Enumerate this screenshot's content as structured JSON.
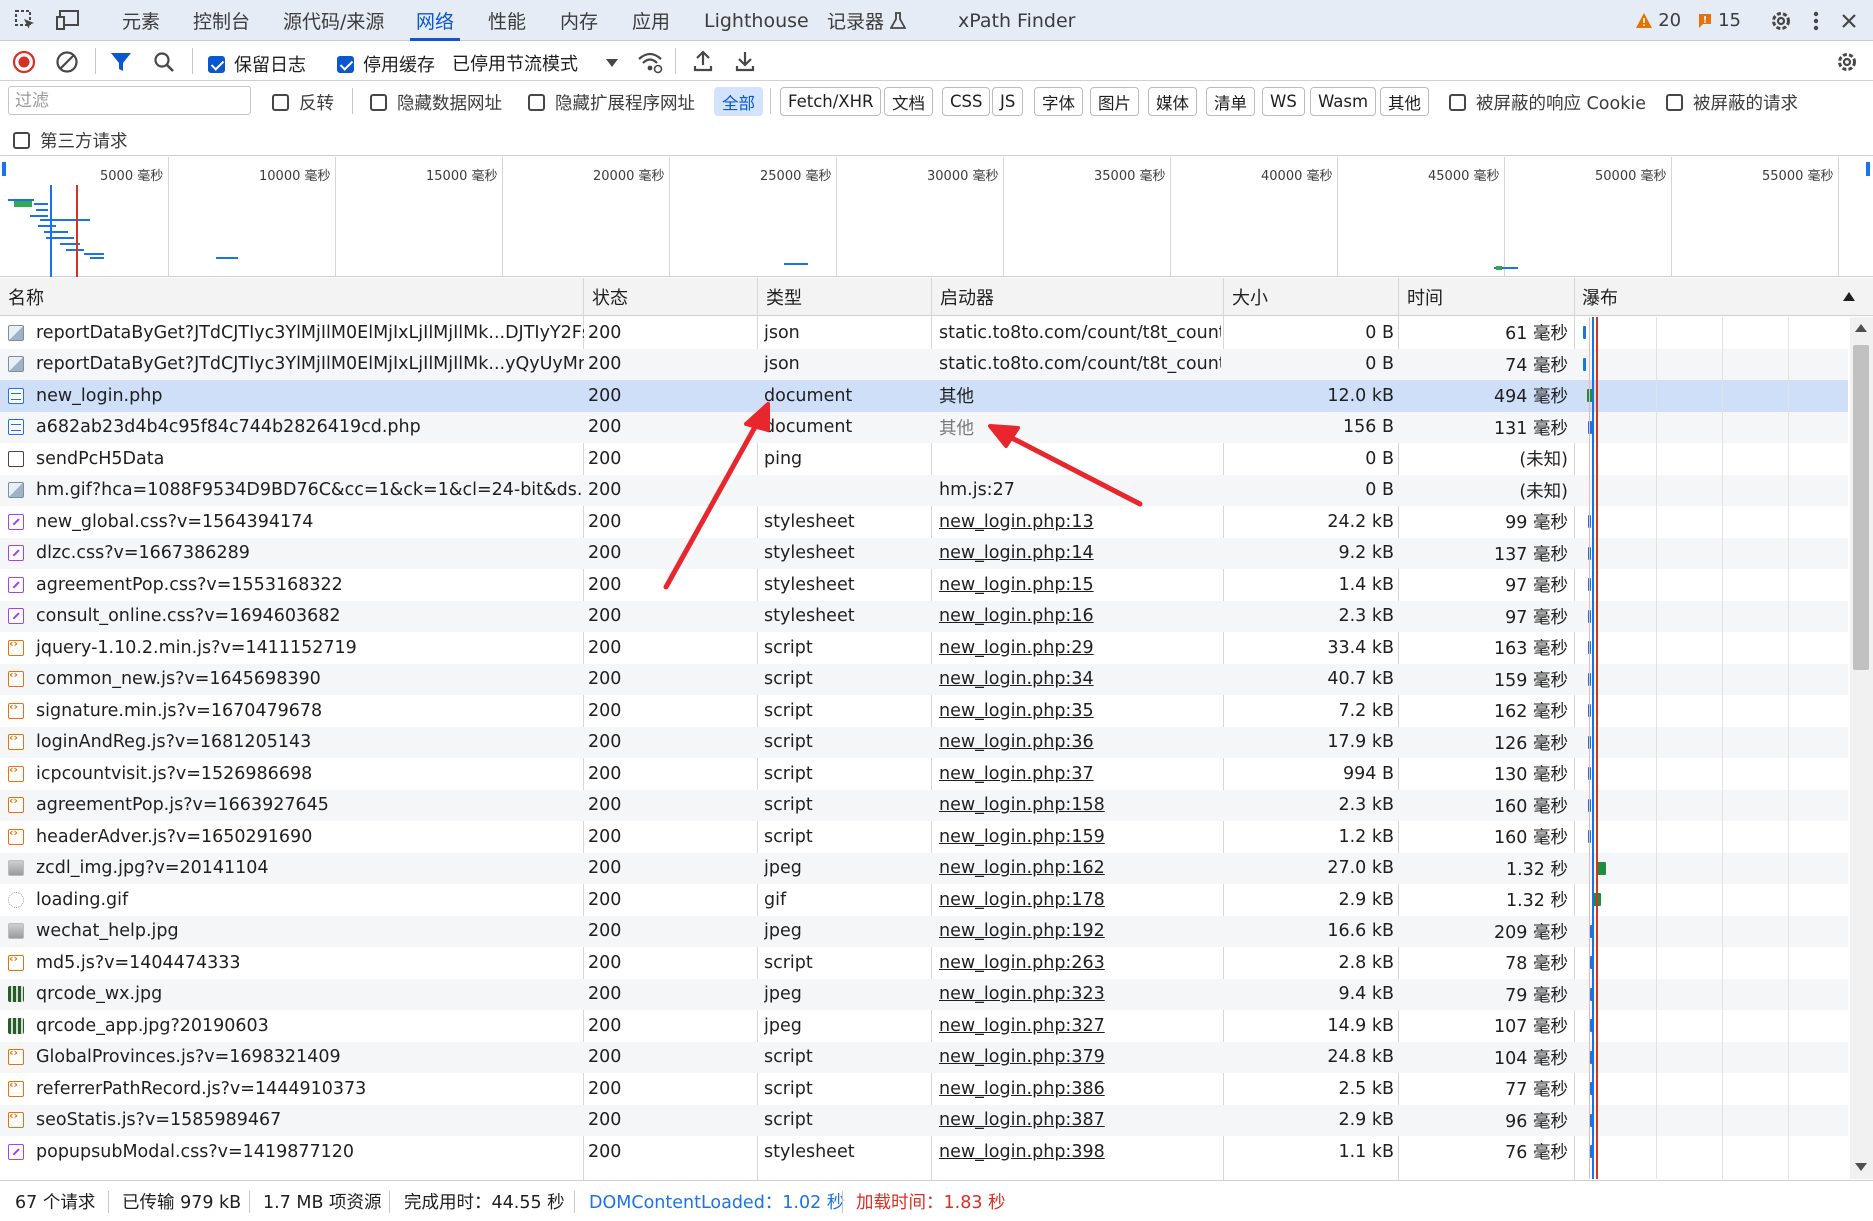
{
  "tabs": [
    "元素",
    "控制台",
    "源代码/来源",
    "网络",
    "性能",
    "内存",
    "应用",
    "Lighthouse",
    "记录器",
    "xPath Finder"
  ],
  "active_tab": "网络",
  "badges": {
    "warnings": "20",
    "issues": "15"
  },
  "toolbar": {
    "preserve_log": "保留日志",
    "disable_cache": "停用缓存",
    "throttling": "已停用节流模式"
  },
  "filter": {
    "placeholder": "过滤",
    "invert": "反转",
    "hide_data_urls": "隐藏数据网址",
    "hide_ext_urls": "隐藏扩展程序网址",
    "types": [
      "全部",
      "Fetch/XHR",
      "文档",
      "CSS",
      "JS",
      "字体",
      "图片",
      "媒体",
      "清单",
      "WS",
      "Wasm",
      "其他"
    ],
    "active_type": "全部",
    "blocked_cookies": "被屏蔽的响应 Cookie",
    "blocked_requests": "被屏蔽的请求",
    "third_party": "第三方请求"
  },
  "overview_ticks": [
    "5000 毫秒",
    "10000 毫秒",
    "15000 毫秒",
    "20000 毫秒",
    "25000 毫秒",
    "30000 毫秒",
    "35000 毫秒",
    "40000 毫秒",
    "45000 毫秒",
    "50000 毫秒",
    "55000 毫秒"
  ],
  "columns": {
    "name": "名称",
    "status": "状态",
    "type": "类型",
    "initiator": "启动器",
    "size": "大小",
    "time": "时间",
    "waterfall": "瀑布"
  },
  "rows": [
    {
      "name": "reportDataByGet?JTdCJTIyc3YlMjIlM0ElMjIxLjIlMjIlMk...DJTIyY2Fsb...",
      "status": "200",
      "type": "json",
      "initiator": "static.to8to.com/count/t8t_count....",
      "size": "0 B",
      "time": "61 毫秒",
      "icon": "image-icon"
    },
    {
      "name": "reportDataByGet?JTdCJTIyc3YlMjIlM0ElMjIxLjIlMjIlMk...yQyUyMm...",
      "status": "200",
      "type": "json",
      "initiator": "static.to8to.com/count/t8t_count....",
      "size": "0 B",
      "time": "74 毫秒",
      "icon": "image-icon"
    },
    {
      "name": "new_login.php",
      "status": "200",
      "type": "document",
      "initiator": "其他",
      "size": "12.0 kB",
      "time": "494 毫秒",
      "icon": "document-icon"
    },
    {
      "name": "a682ab23d4b4c95f84c744b2826419cd.php",
      "status": "200",
      "type": "document",
      "initiator": "其他",
      "size": "156 B",
      "time": "131 毫秒",
      "icon": "document-icon"
    },
    {
      "name": "sendPcH5Data",
      "status": "200",
      "type": "ping",
      "initiator": "",
      "size": "0 B",
      "time": "(未知)",
      "icon": "ping-icon"
    },
    {
      "name": "hm.gif?hca=1088F9534D9BD76C&cc=1&ck=1&cl=24-bit&ds...44...",
      "status": "200",
      "type": "",
      "initiator": "hm.js:27",
      "size": "0 B",
      "time": "(未知)",
      "icon": "image-icon"
    },
    {
      "name": "new_global.css?v=1564394174",
      "status": "200",
      "type": "stylesheet",
      "initiator": "new_login.php:13",
      "size": "24.2 kB",
      "time": "99 毫秒",
      "icon": "stylesheet-icon"
    },
    {
      "name": "dlzc.css?v=1667386289",
      "status": "200",
      "type": "stylesheet",
      "initiator": "new_login.php:14",
      "size": "9.2 kB",
      "time": "137 毫秒",
      "icon": "stylesheet-icon"
    },
    {
      "name": "agreementPop.css?v=1553168322",
      "status": "200",
      "type": "stylesheet",
      "initiator": "new_login.php:15",
      "size": "1.4 kB",
      "time": "97 毫秒",
      "icon": "stylesheet-icon"
    },
    {
      "name": "consult_online.css?v=1694603682",
      "status": "200",
      "type": "stylesheet",
      "initiator": "new_login.php:16",
      "size": "2.3 kB",
      "time": "97 毫秒",
      "icon": "stylesheet-icon"
    },
    {
      "name": "jquery-1.10.2.min.js?v=1411152719",
      "status": "200",
      "type": "script",
      "initiator": "new_login.php:29",
      "size": "33.4 kB",
      "time": "163 毫秒",
      "icon": "script-icon"
    },
    {
      "name": "common_new.js?v=1645698390",
      "status": "200",
      "type": "script",
      "initiator": "new_login.php:34",
      "size": "40.7 kB",
      "time": "159 毫秒",
      "icon": "script-icon"
    },
    {
      "name": "signature.min.js?v=1670479678",
      "status": "200",
      "type": "script",
      "initiator": "new_login.php:35",
      "size": "7.2 kB",
      "time": "162 毫秒",
      "icon": "script-icon"
    },
    {
      "name": "loginAndReg.js?v=1681205143",
      "status": "200",
      "type": "script",
      "initiator": "new_login.php:36",
      "size": "17.9 kB",
      "time": "126 毫秒",
      "icon": "script-icon"
    },
    {
      "name": "icpcountvisit.js?v=1526986698",
      "status": "200",
      "type": "script",
      "initiator": "new_login.php:37",
      "size": "994 B",
      "time": "130 毫秒",
      "icon": "script-icon"
    },
    {
      "name": "agreementPop.js?v=1663927645",
      "status": "200",
      "type": "script",
      "initiator": "new_login.php:158",
      "size": "2.3 kB",
      "time": "160 毫秒",
      "icon": "script-icon"
    },
    {
      "name": "headerAdver.js?v=1650291690",
      "status": "200",
      "type": "script",
      "initiator": "new_login.php:159",
      "size": "1.2 kB",
      "time": "160 毫秒",
      "icon": "script-icon"
    },
    {
      "name": "zcdl_img.jpg?v=20141104",
      "status": "200",
      "type": "jpeg",
      "initiator": "new_login.php:162",
      "size": "27.0 kB",
      "time": "1.32 秒",
      "icon": "jpeg-thumbnail-icon"
    },
    {
      "name": "loading.gif",
      "status": "200",
      "type": "gif",
      "initiator": "new_login.php:178",
      "size": "2.9 kB",
      "time": "1.32 秒",
      "icon": "gif-thumbnail-icon"
    },
    {
      "name": "wechat_help.jpg",
      "status": "200",
      "type": "jpeg",
      "initiator": "new_login.php:192",
      "size": "16.6 kB",
      "time": "209 毫秒",
      "icon": "jpeg-thumbnail-icon"
    },
    {
      "name": "md5.js?v=1404474333",
      "status": "200",
      "type": "script",
      "initiator": "new_login.php:263",
      "size": "2.8 kB",
      "time": "78 毫秒",
      "icon": "script-icon"
    },
    {
      "name": "qrcode_wx.jpg",
      "status": "200",
      "type": "jpeg",
      "initiator": "new_login.php:323",
      "size": "9.4 kB",
      "time": "79 毫秒",
      "icon": "qrcode-thumbnail-icon"
    },
    {
      "name": "qrcode_app.jpg?20190603",
      "status": "200",
      "type": "jpeg",
      "initiator": "new_login.php:327",
      "size": "14.9 kB",
      "time": "107 毫秒",
      "icon": "qrcode-thumbnail-icon"
    },
    {
      "name": "GlobalProvinces.js?v=1698321409",
      "status": "200",
      "type": "script",
      "initiator": "new_login.php:379",
      "size": "24.8 kB",
      "time": "104 毫秒",
      "icon": "script-icon"
    },
    {
      "name": "referrerPathRecord.js?v=1444910373",
      "status": "200",
      "type": "script",
      "initiator": "new_login.php:386",
      "size": "2.5 kB",
      "time": "77 毫秒",
      "icon": "script-icon"
    },
    {
      "name": "seoStatis.js?v=1585989467",
      "status": "200",
      "type": "script",
      "initiator": "new_login.php:387",
      "size": "2.9 kB",
      "time": "96 毫秒",
      "icon": "script-icon"
    },
    {
      "name": "popupsubModal.css?v=1419877120",
      "status": "200",
      "type": "stylesheet",
      "initiator": "new_login.php:398",
      "size": "1.1 kB",
      "time": "76 毫秒",
      "icon": "stylesheet-icon"
    }
  ],
  "status_bar": {
    "requests": "67 个请求",
    "transferred": "已传输 979 kB",
    "resources": "1.7 MB 项资源",
    "finish": "完成用时：44.55 秒",
    "dcl": "DOMContentLoaded：1.02 秒",
    "load": "加载时间：1.83 秒"
  },
  "colors": {
    "accent": "#0b57d0",
    "dcl": "#1a73e8",
    "load": "#d93025",
    "annotation_arrow": "#e8262d"
  }
}
